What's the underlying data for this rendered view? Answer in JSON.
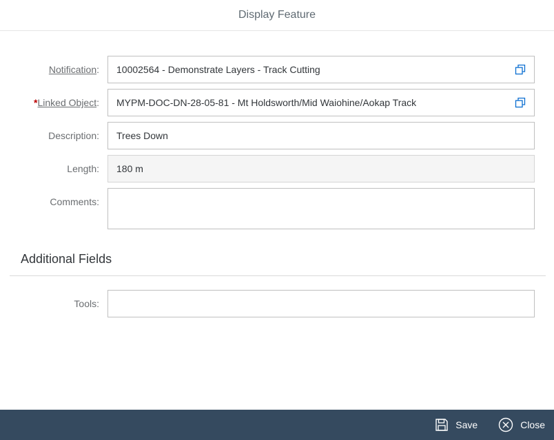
{
  "dialog": {
    "title": "Display Feature"
  },
  "form": {
    "notification": {
      "label": "Notification",
      "suffix": ":",
      "value": "10002564 - Demonstrate Layers - Track Cutting",
      "icon": "copy-icon"
    },
    "linked_object": {
      "required_mark": "*",
      "label": "Linked Object",
      "suffix": ":",
      "value": "MYPM-DOC-DN-28-05-81 - Mt Holdsworth/Mid Waiohine/Aokap Track",
      "icon": "copy-icon"
    },
    "description": {
      "label": "Description:",
      "value": "Trees Down"
    },
    "length": {
      "label": "Length:",
      "value": "180 m"
    },
    "comments": {
      "label": "Comments:",
      "value": ""
    }
  },
  "additional": {
    "title": "Additional Fields",
    "tools": {
      "label": "Tools:",
      "value": ""
    }
  },
  "footer": {
    "save_label": "Save",
    "close_label": "Close"
  },
  "colors": {
    "footer_bg": "#354a5f",
    "required": "#bb0000",
    "icon": "#0a6ed1"
  }
}
